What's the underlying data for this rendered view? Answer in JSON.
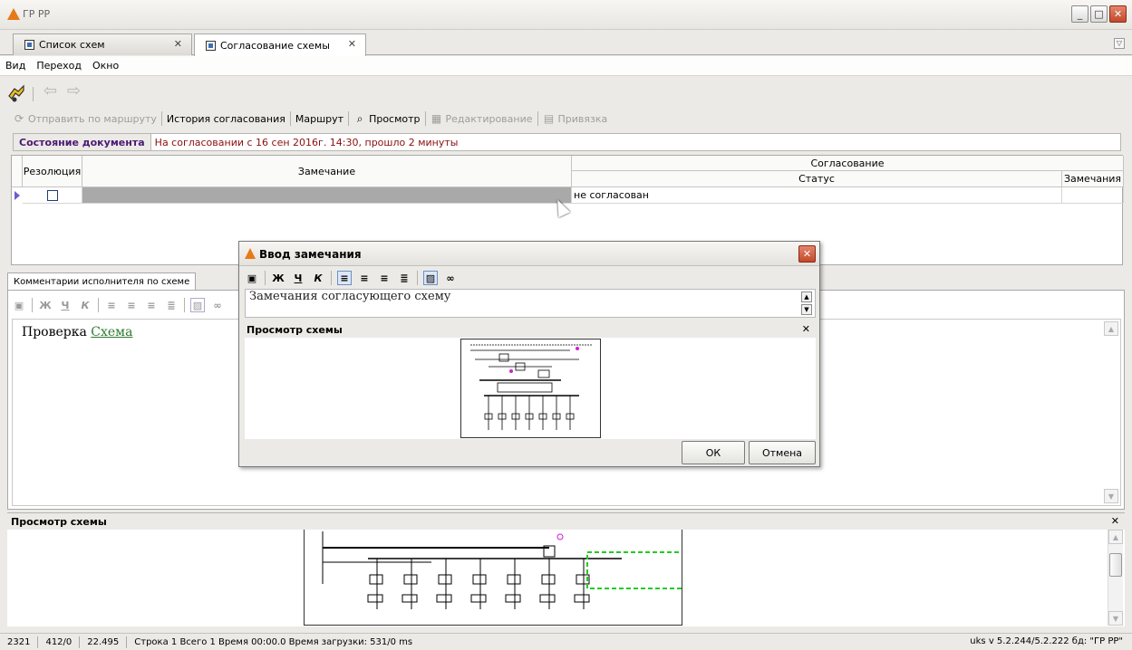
{
  "app": {
    "title": "ГР РР"
  },
  "tabs": [
    {
      "label": "Список схем"
    },
    {
      "label": "Согласование схемы"
    }
  ],
  "menu": [
    "Вид",
    "Переход",
    "Окно"
  ],
  "actions": {
    "send": "Отправить по маршруту",
    "history": "История согласования",
    "route": "Маршрут",
    "view": "Просмотр",
    "edit": "Редактирование",
    "bind": "Привязка"
  },
  "doc_state": {
    "label": "Состояние документа",
    "value": "На согласовании с 16 сен 2016г. 14:30, прошло 2 минуты"
  },
  "grid": {
    "headers": {
      "resolution": "Резолюция",
      "remark": "Замечание",
      "approval": "Согласование",
      "status": "Статус",
      "remarks": "Замечания"
    },
    "rows": [
      {
        "status": "не согласован"
      }
    ]
  },
  "lower_panel": {
    "tab": "Комментарии исполнителя по схеме",
    "text": "Проверка",
    "link": "Схема"
  },
  "preview": {
    "title": "Просмотр схемы"
  },
  "dialog": {
    "title": "Ввод замечания",
    "text": "Замечания согласующего схему",
    "preview_title": "Просмотр схемы",
    "ok": "ОК",
    "cancel": "Отмена"
  },
  "format_buttons": [
    "Ж",
    "Ч",
    "К"
  ],
  "statusbar": {
    "items": [
      "2321",
      "412/0",
      "22.495",
      "Строка 1 Всего 1 Время 00:00.0  Время загрузки: 531/0 ms"
    ],
    "version": "uks  v 5.2.244/5.2.222  бд: \"ГР РР\""
  },
  "colors": {
    "doc_state_label": "#4b1a74",
    "doc_state_value": "#8b0e0e",
    "link": "#2e7a2e",
    "selection_dashed": "#22cc22"
  }
}
